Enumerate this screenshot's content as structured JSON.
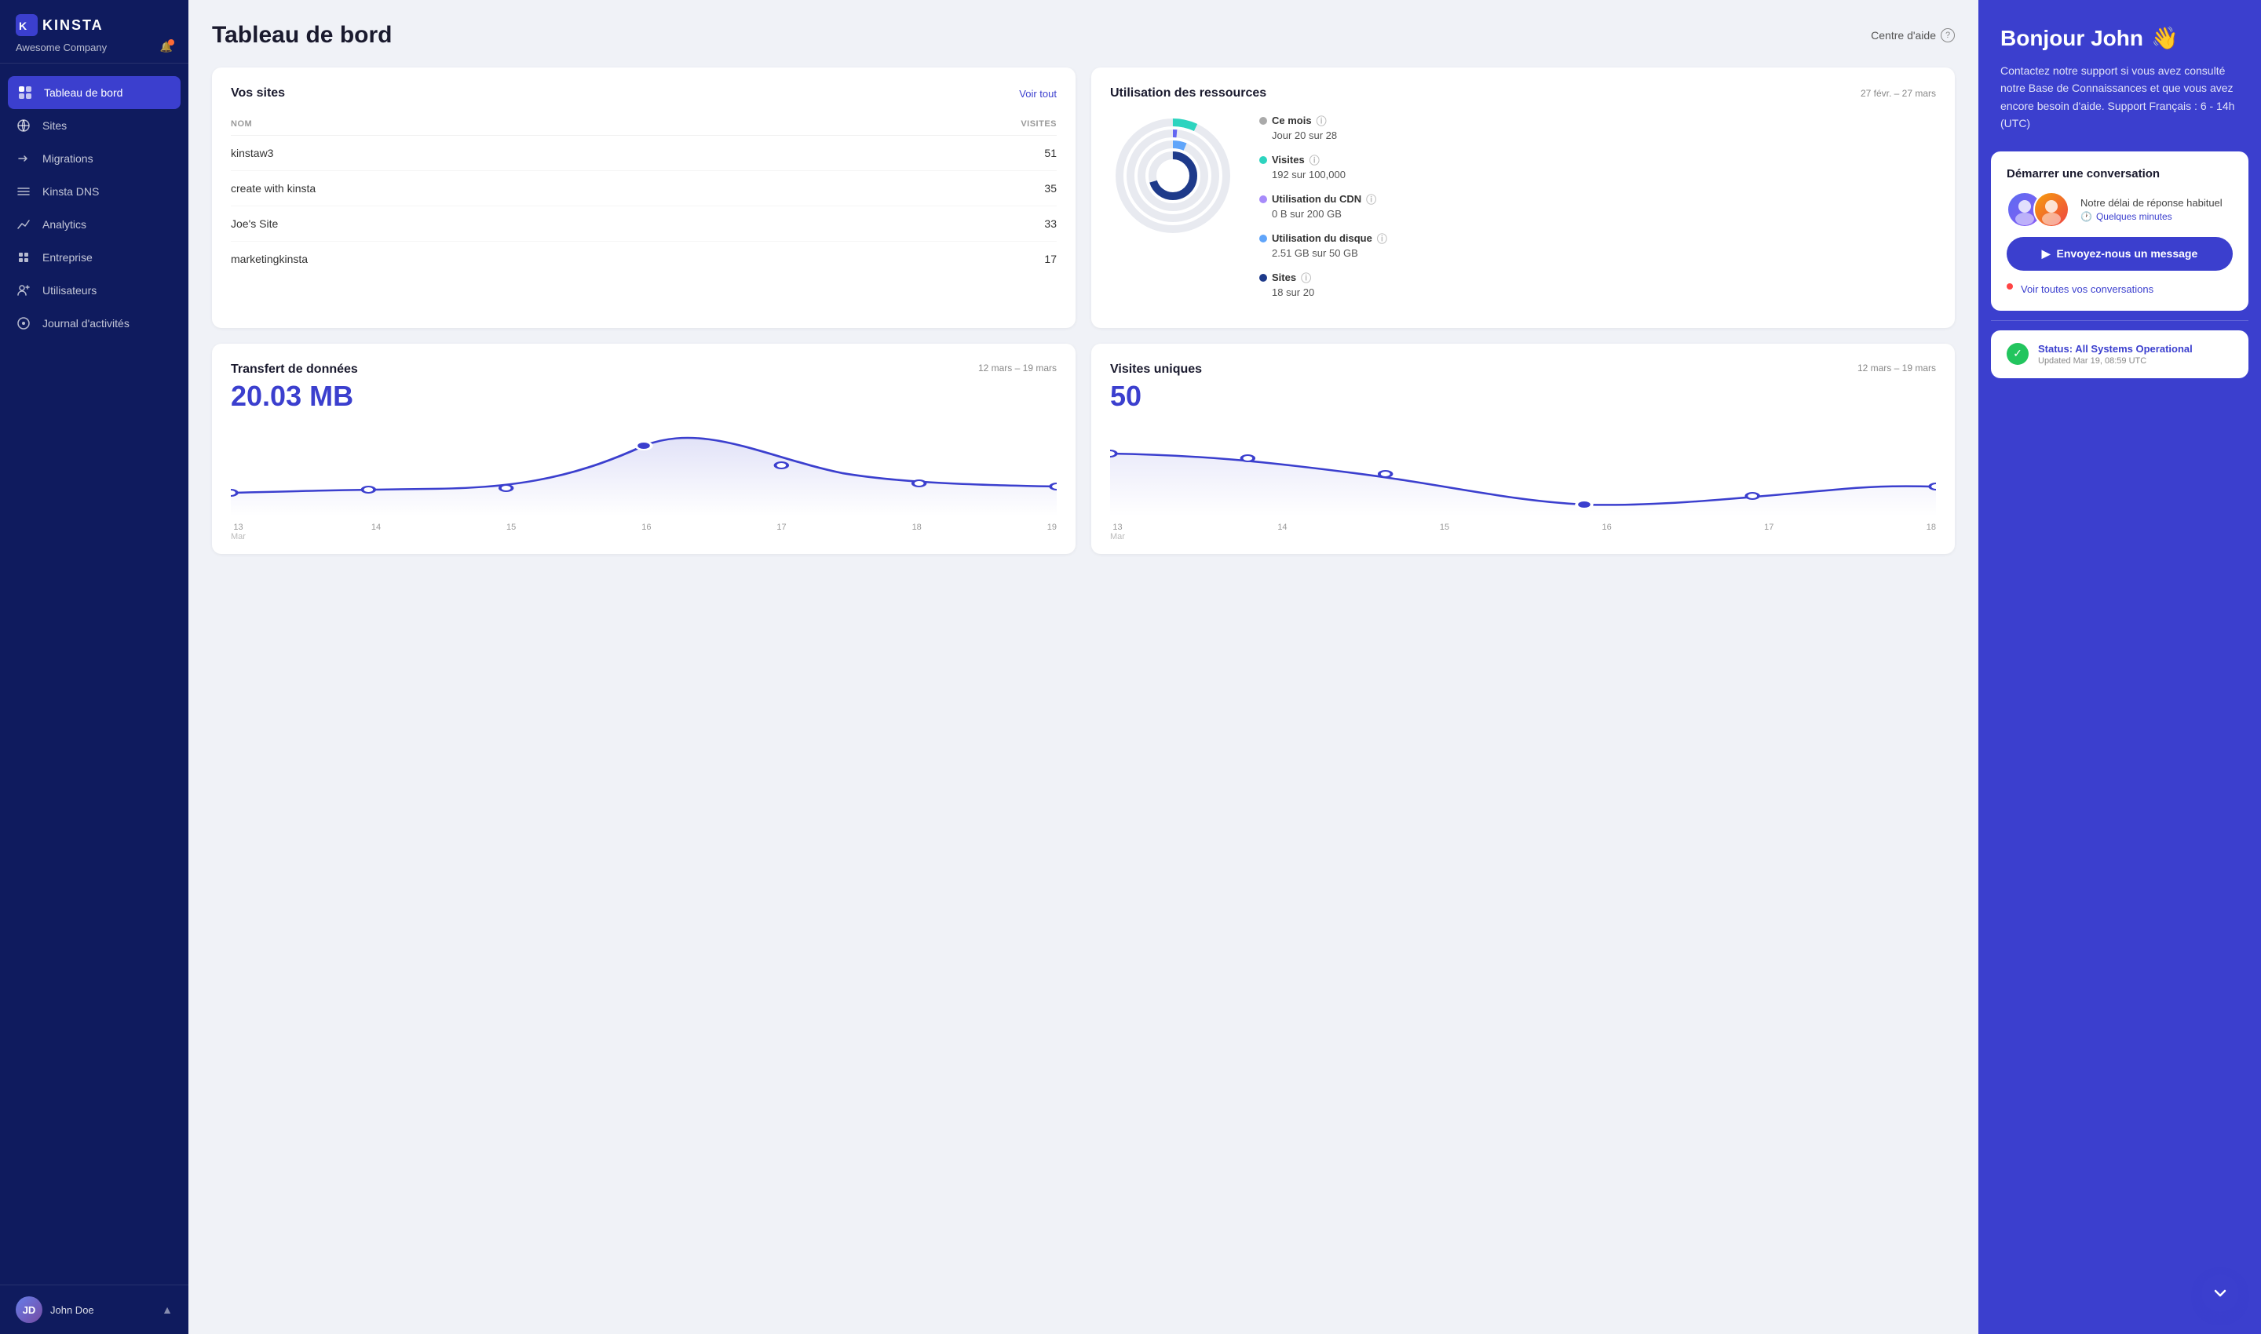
{
  "sidebar": {
    "logo": "kinsta",
    "company": "Awesome Company",
    "nav": [
      {
        "id": "tableau",
        "label": "Tableau de bord",
        "icon": "⊙",
        "active": true
      },
      {
        "id": "sites",
        "label": "Sites",
        "icon": "◇"
      },
      {
        "id": "migrations",
        "label": "Migrations",
        "icon": "→"
      },
      {
        "id": "dns",
        "label": "Kinsta DNS",
        "icon": "≋"
      },
      {
        "id": "analytics",
        "label": "Analytics",
        "icon": "↗"
      },
      {
        "id": "entreprise",
        "label": "Entreprise",
        "icon": "▦"
      },
      {
        "id": "utilisateurs",
        "label": "Utilisateurs",
        "icon": "✦"
      },
      {
        "id": "journal",
        "label": "Journal d'activités",
        "icon": "◉"
      }
    ],
    "user": {
      "name": "John Doe",
      "initials": "JD"
    }
  },
  "header": {
    "title": "Tableau de bord",
    "help_label": "Centre d'aide"
  },
  "sites_card": {
    "title": "Vos sites",
    "link": "Voir tout",
    "col_nom": "NOM",
    "col_visites": "VISITES",
    "sites": [
      {
        "name": "kinstaw3",
        "visits": "51"
      },
      {
        "name": "create with kinsta",
        "visits": "35"
      },
      {
        "name": "Joe's Site",
        "visits": "33"
      },
      {
        "name": "marketingkinsta",
        "visits": "17"
      }
    ]
  },
  "resources_card": {
    "title": "Utilisation des ressources",
    "date_range": "27 févr. – 27 mars",
    "stats": [
      {
        "id": "mois",
        "label": "Ce mois",
        "value": "Jour 20 sur 28",
        "color": "#aaa"
      },
      {
        "id": "visites",
        "label": "Visites",
        "value": "192 sur 100,000",
        "color": "#2dd4bf"
      },
      {
        "id": "cdn",
        "label": "Utilisation du CDN",
        "value": "0 B sur 200 GB",
        "color": "#a78bfa"
      },
      {
        "id": "disque",
        "label": "Utilisation du disque",
        "value": "2.51 GB sur 50 GB",
        "color": "#60a5fa"
      },
      {
        "id": "sites",
        "label": "Sites",
        "value": "18 sur 20",
        "color": "#1e3a8a"
      }
    ]
  },
  "transfert_card": {
    "title": "Transfert de données",
    "date_range": "12 mars – 19 mars",
    "value": "20.03 MB",
    "labels": [
      {
        "day": "13",
        "month": "Mar"
      },
      {
        "day": "14",
        "month": ""
      },
      {
        "day": "15",
        "month": ""
      },
      {
        "day": "16",
        "month": ""
      },
      {
        "day": "17",
        "month": ""
      },
      {
        "day": "18",
        "month": ""
      },
      {
        "day": "19",
        "month": ""
      }
    ]
  },
  "visites_card": {
    "title": "Visites uniques",
    "date_range": "12 mars – 19 mars",
    "value": "50",
    "labels": [
      {
        "day": "13",
        "month": "Mar"
      },
      {
        "day": "14",
        "month": ""
      },
      {
        "day": "15",
        "month": ""
      },
      {
        "day": "16",
        "month": ""
      },
      {
        "day": "17",
        "month": ""
      },
      {
        "day": "18",
        "month": ""
      }
    ]
  },
  "support_panel": {
    "greeting": "Bonjour John",
    "emoji": "👋",
    "description": "Contactez notre support si vous avez consulté notre Base de Connaissances et que vous avez encore besoin d'aide. Support Français : 6 - 14h (UTC)",
    "conversation_title": "Démarrer une conversation",
    "response_label": "Notre délai de réponse habituel",
    "response_time": "Quelques minutes",
    "send_btn": "Envoyez-nous un message",
    "conversations_link": "Voir toutes vos conversations",
    "status": {
      "label": "Status: All Systems Operational",
      "updated": "Updated Mar 19, 08:59 UTC"
    }
  }
}
